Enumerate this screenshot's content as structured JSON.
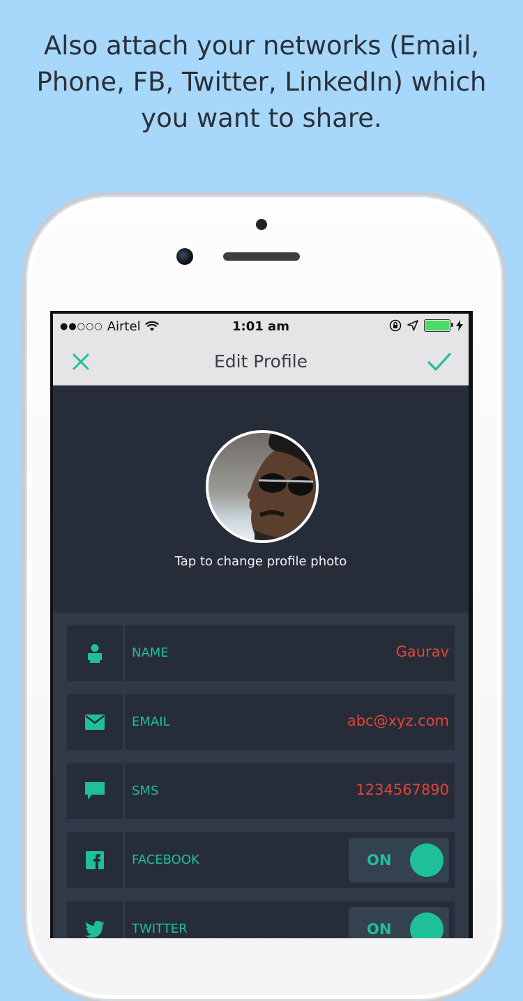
{
  "promo": {
    "line1": "Also attach your networks (Email,",
    "line2": "Phone, FB, Twitter, LinkedIn) which",
    "line3": "you want to share."
  },
  "status_bar": {
    "signal": "●●○○○",
    "carrier": "Airtel",
    "time": "1:01 am"
  },
  "nav": {
    "title": "Edit Profile",
    "close_icon": "close-icon",
    "done_icon": "checkmark-icon"
  },
  "profile": {
    "photo_hint": "Tap to change profile photo"
  },
  "fields": [
    {
      "icon": "person-icon",
      "label": "NAME",
      "value": "Gaurav"
    },
    {
      "icon": "envelope-icon",
      "label": "EMAIL",
      "value": "abc@xyz.com"
    },
    {
      "icon": "chat-bubble-icon",
      "label": "SMS",
      "value": "1234567890"
    },
    {
      "icon": "facebook-icon",
      "label": "FACEBOOK",
      "toggle": "ON"
    },
    {
      "icon": "twitter-icon",
      "label": "TWITTER",
      "toggle": "ON"
    }
  ],
  "colors": {
    "background": "#a7d8fb",
    "accent": "#1fbf9a",
    "value_text": "#e0453a",
    "panel": "#272d38"
  }
}
